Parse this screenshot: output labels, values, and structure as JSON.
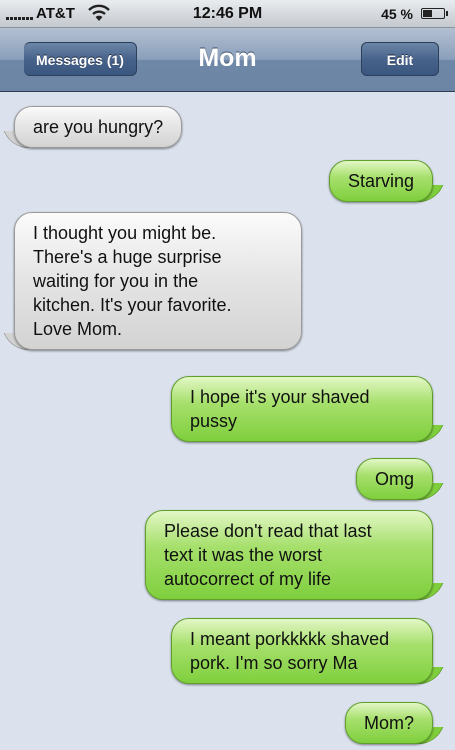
{
  "status_bar": {
    "carrier": "AT&T",
    "time": "12:46 PM",
    "battery_percent_label": "45 %",
    "battery_level": 0.45,
    "signal_icon": "signal-bars-icon",
    "wifi_icon": "wifi-icon"
  },
  "nav": {
    "back_label": "Messages (1)",
    "title": "Mom",
    "edit_label": "Edit"
  },
  "colors": {
    "incoming_bubble": "#e0e0e0",
    "outgoing_bubble": "#9bdb5c",
    "background": "#dbe2ed",
    "nav_bar": "#7f95b2"
  },
  "messages": [
    {
      "direction": "incoming",
      "text": "are you hungry?"
    },
    {
      "direction": "outgoing",
      "text": "Starving"
    },
    {
      "direction": "incoming",
      "text": "I thought you might be.\nThere's a huge surprise\nwaiting for you in the\nkitchen. It's your favorite.\nLove Mom."
    },
    {
      "direction": "outgoing",
      "text": "I hope it's your shaved\npussy"
    },
    {
      "direction": "outgoing",
      "text": "Omg"
    },
    {
      "direction": "outgoing",
      "text": "Please don't read that last\ntext it was the worst\nautocorrect of my life"
    },
    {
      "direction": "outgoing",
      "text": "I meant porkkkkk shaved\npork. I'm so sorry Ma"
    },
    {
      "direction": "outgoing",
      "text": "Mom?"
    }
  ]
}
